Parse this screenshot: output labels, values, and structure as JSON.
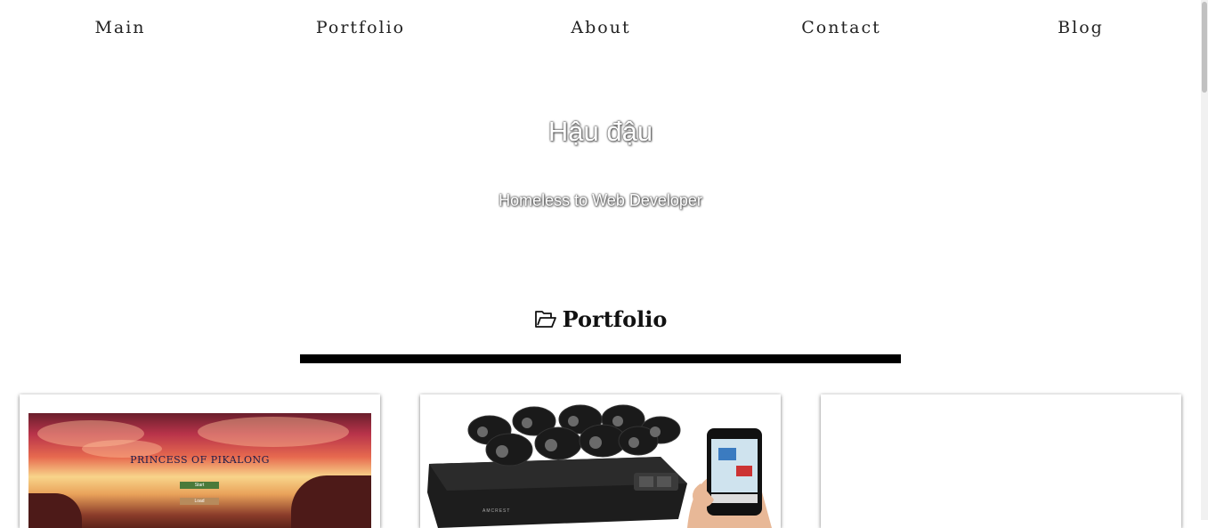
{
  "nav": {
    "items": [
      {
        "label": "Main"
      },
      {
        "label": "Portfolio"
      },
      {
        "label": "About"
      },
      {
        "label": "Contact"
      },
      {
        "label": "Blog"
      }
    ]
  },
  "hero": {
    "title": "Hậu đậu",
    "subtitle": "Homeless to Web Developer"
  },
  "portfolio": {
    "heading": "Portfolio",
    "heading_icon": "folder-open-icon",
    "cards": [
      {
        "game_title": "PRINCESS OF PIKALONG",
        "start_label": "Start",
        "load_label": "Load"
      },
      {
        "brand_label": "AMCREST"
      },
      {}
    ]
  },
  "colors": {
    "rule": "#000000",
    "background": "#ffffff"
  }
}
